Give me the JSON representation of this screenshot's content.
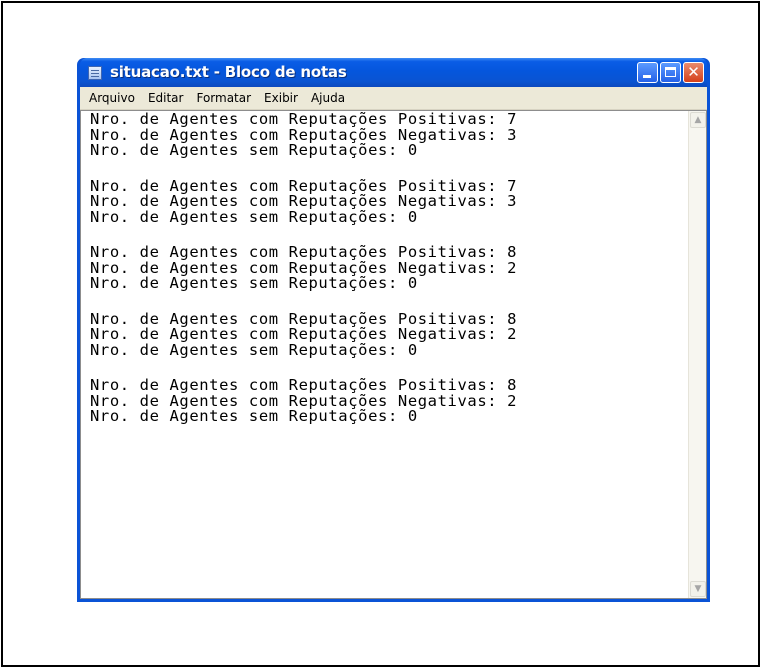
{
  "window": {
    "title": "situacao.txt - Bloco de notas",
    "buttons": {
      "minimize": "",
      "maximize": "",
      "close": "✕"
    }
  },
  "menu": [
    "Arquivo",
    "Editar",
    "Formatar",
    "Exibir",
    "Ajuda"
  ],
  "document": {
    "blocks": [
      [
        "Nro. de Agentes com Reputações Positivas: 7",
        "Nro. de Agentes com Reputações Negativas: 3",
        "Nro. de Agentes sem Reputações: 0"
      ],
      [
        "Nro. de Agentes com Reputações Positivas: 7",
        "Nro. de Agentes com Reputações Negativas: 3",
        "Nro. de Agentes sem Reputações: 0"
      ],
      [
        "Nro. de Agentes com Reputações Positivas: 8",
        "Nro. de Agentes com Reputações Negativas: 2",
        "Nro. de Agentes sem Reputações: 0"
      ],
      [
        "Nro. de Agentes com Reputações Positivas: 8",
        "Nro. de Agentes com Reputações Negativas: 2",
        "Nro. de Agentes sem Reputações: 0"
      ],
      [
        "Nro. de Agentes com Reputações Positivas: 8",
        "Nro. de Agentes com Reputações Negativas: 2",
        "Nro. de Agentes sem Reputações: 0"
      ]
    ]
  },
  "scrollbar": {
    "up_icon": "▲",
    "down_icon": "▼"
  }
}
